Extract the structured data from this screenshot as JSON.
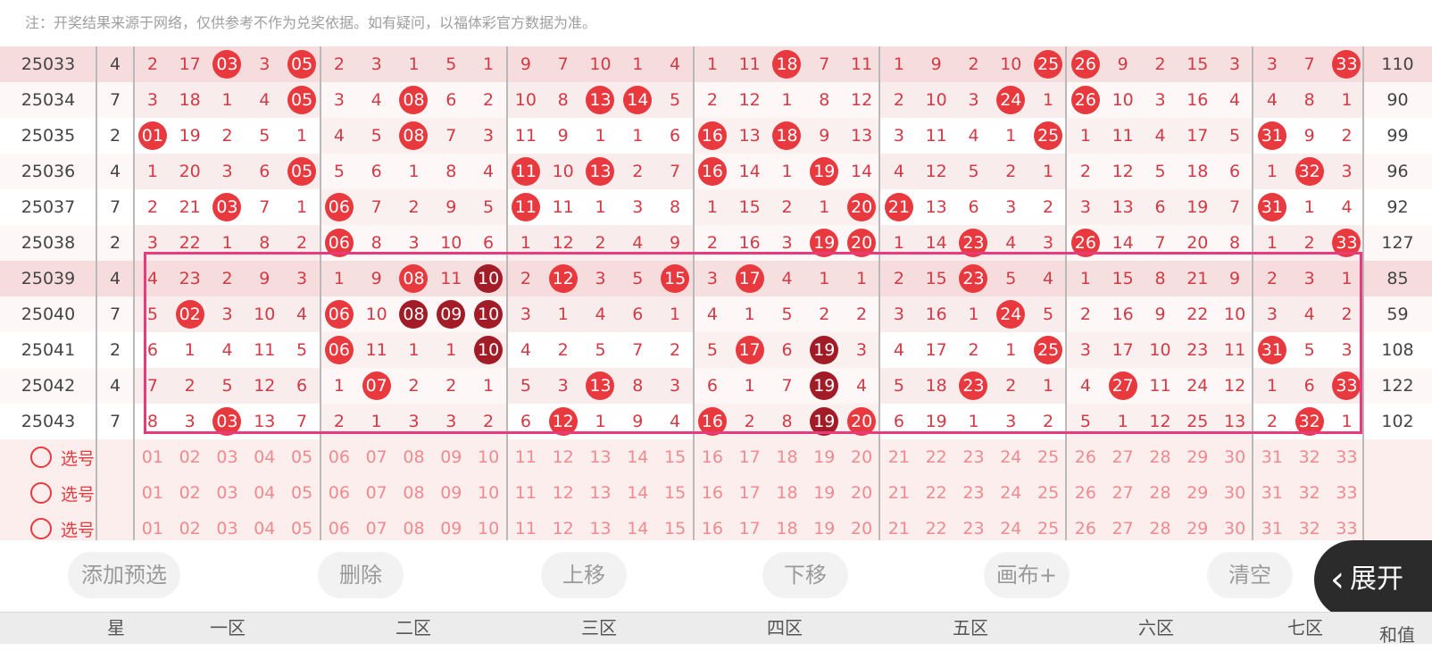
{
  "note": "注：开奖结果来源于网络，仅供参考不作为兑奖依据。如有疑问，以福体彩官方数据为准。",
  "draws": [
    {
      "issue": "25033",
      "star": "4",
      "sum": "110",
      "cells": [
        "2",
        "17",
        "03",
        "3",
        "05",
        "2",
        "3",
        "1",
        "5",
        "1",
        "9",
        "7",
        "10",
        "1",
        "4",
        "1",
        "11",
        "18",
        "7",
        "11",
        "1",
        "9",
        "2",
        "10",
        "25",
        "26",
        "9",
        "2",
        "15",
        "3",
        "3",
        "7",
        "33"
      ],
      "hits": [
        2,
        4,
        17,
        24,
        25,
        32
      ]
    },
    {
      "issue": "25034",
      "star": "7",
      "sum": "90",
      "cells": [
        "3",
        "18",
        "1",
        "4",
        "05",
        "3",
        "4",
        "08",
        "6",
        "2",
        "10",
        "8",
        "13",
        "14",
        "5",
        "2",
        "12",
        "1",
        "8",
        "12",
        "2",
        "10",
        "3",
        "24",
        "1",
        "26",
        "10",
        "3",
        "16",
        "4",
        "4",
        "8",
        "1"
      ],
      "hits": [
        4,
        7,
        12,
        13,
        23,
        25
      ]
    },
    {
      "issue": "25035",
      "star": "2",
      "sum": "99",
      "cells": [
        "01",
        "19",
        "2",
        "5",
        "1",
        "4",
        "5",
        "08",
        "7",
        "3",
        "11",
        "9",
        "1",
        "1",
        "6",
        "16",
        "13",
        "18",
        "9",
        "13",
        "3",
        "11",
        "4",
        "1",
        "25",
        "1",
        "11",
        "4",
        "17",
        "5",
        "31",
        "9",
        "2"
      ],
      "hits": [
        0,
        7,
        15,
        17,
        24,
        30
      ]
    },
    {
      "issue": "25036",
      "star": "4",
      "sum": "96",
      "cells": [
        "1",
        "20",
        "3",
        "6",
        "05",
        "5",
        "6",
        "1",
        "8",
        "4",
        "11",
        "10",
        "13",
        "2",
        "7",
        "16",
        "14",
        "1",
        "19",
        "14",
        "4",
        "12",
        "5",
        "2",
        "1",
        "2",
        "12",
        "5",
        "18",
        "6",
        "1",
        "32",
        "3"
      ],
      "hits": [
        4,
        10,
        12,
        15,
        18,
        31
      ]
    },
    {
      "issue": "25037",
      "star": "7",
      "sum": "92",
      "cells": [
        "2",
        "21",
        "03",
        "7",
        "1",
        "06",
        "7",
        "2",
        "9",
        "5",
        "11",
        "11",
        "1",
        "3",
        "8",
        "1",
        "15",
        "2",
        "1",
        "20",
        "21",
        "13",
        "6",
        "3",
        "2",
        "3",
        "13",
        "6",
        "19",
        "7",
        "31",
        "1",
        "4"
      ],
      "hits": [
        2,
        5,
        10,
        19,
        20,
        30
      ]
    },
    {
      "issue": "25038",
      "star": "2",
      "sum": "127",
      "cells": [
        "3",
        "22",
        "1",
        "8",
        "2",
        "06",
        "8",
        "3",
        "10",
        "6",
        "1",
        "12",
        "2",
        "4",
        "9",
        "2",
        "16",
        "3",
        "19",
        "20",
        "1",
        "14",
        "23",
        "4",
        "3",
        "26",
        "14",
        "7",
        "20",
        "8",
        "1",
        "2",
        "33"
      ],
      "hits": [
        5,
        18,
        19,
        22,
        25,
        32
      ]
    },
    {
      "issue": "25039",
      "star": "4",
      "sum": "85",
      "cells": [
        "4",
        "23",
        "2",
        "9",
        "3",
        "1",
        "9",
        "08",
        "11",
        "10",
        "2",
        "12",
        "3",
        "5",
        "15",
        "3",
        "17",
        "4",
        "1",
        "1",
        "2",
        "15",
        "23",
        "5",
        "4",
        "1",
        "15",
        "8",
        "21",
        "9",
        "2",
        "3",
        "1"
      ],
      "hits": [
        7,
        9,
        11,
        14,
        16,
        22
      ],
      "dark": [
        9
      ]
    },
    {
      "issue": "25040",
      "star": "7",
      "sum": "59",
      "cells": [
        "5",
        "02",
        "3",
        "10",
        "4",
        "06",
        "10",
        "08",
        "09",
        "10",
        "3",
        "1",
        "4",
        "6",
        "1",
        "4",
        "1",
        "5",
        "2",
        "2",
        "3",
        "16",
        "1",
        "24",
        "5",
        "2",
        "16",
        "9",
        "22",
        "10",
        "3",
        "4",
        "2"
      ],
      "hits": [
        1,
        5,
        7,
        8,
        9,
        23
      ],
      "dark": [
        7,
        8,
        9
      ]
    },
    {
      "issue": "25041",
      "star": "2",
      "sum": "108",
      "cells": [
        "6",
        "1",
        "4",
        "11",
        "5",
        "06",
        "11",
        "1",
        "1",
        "10",
        "4",
        "2",
        "5",
        "7",
        "2",
        "5",
        "17",
        "6",
        "19",
        "3",
        "4",
        "17",
        "2",
        "1",
        "25",
        "3",
        "17",
        "10",
        "23",
        "11",
        "31",
        "5",
        "3"
      ],
      "hits": [
        5,
        9,
        16,
        18,
        24,
        30
      ],
      "dark": [
        9,
        18
      ]
    },
    {
      "issue": "25042",
      "star": "4",
      "sum": "122",
      "cells": [
        "7",
        "2",
        "5",
        "12",
        "6",
        "1",
        "07",
        "2",
        "2",
        "1",
        "5",
        "3",
        "13",
        "8",
        "3",
        "6",
        "1",
        "7",
        "19",
        "4",
        "5",
        "18",
        "23",
        "2",
        "1",
        "4",
        "27",
        "11",
        "24",
        "12",
        "1",
        "6",
        "33"
      ],
      "hits": [
        6,
        12,
        18,
        22,
        26,
        32
      ],
      "dark": [
        18
      ]
    },
    {
      "issue": "25043",
      "star": "7",
      "sum": "102",
      "cells": [
        "8",
        "3",
        "03",
        "13",
        "7",
        "2",
        "1",
        "3",
        "3",
        "2",
        "6",
        "12",
        "1",
        "9",
        "4",
        "16",
        "2",
        "8",
        "19",
        "20",
        "6",
        "19",
        "1",
        "3",
        "2",
        "5",
        "1",
        "12",
        "25",
        "13",
        "2",
        "32",
        "1"
      ],
      "hits": [
        2,
        11,
        15,
        18,
        19,
        31
      ],
      "dark": [
        18
      ]
    }
  ],
  "select_label": "选号",
  "select_numbers": [
    "01",
    "02",
    "03",
    "04",
    "05",
    "06",
    "07",
    "08",
    "09",
    "10",
    "11",
    "12",
    "13",
    "14",
    "15",
    "16",
    "17",
    "18",
    "19",
    "20",
    "21",
    "22",
    "23",
    "24",
    "25",
    "26",
    "27",
    "28",
    "29",
    "30",
    "31",
    "32",
    "33"
  ],
  "toolbar": {
    "add_preselect": "添加预选",
    "delete": "删除",
    "move_up": "上移",
    "move_down": "下移",
    "canvas_plus": "画布+",
    "clear": "清空",
    "expand": "展开",
    "expand_chevron": "‹"
  },
  "zones": {
    "star": "星",
    "z1": "一区",
    "z2": "二区",
    "z3": "三区",
    "z4": "四区",
    "z5": "五区",
    "z6": "六区",
    "z7": "七区",
    "sum": "和值"
  },
  "colors": {
    "ball": "#e8393f",
    "ball_dark": "#a11c26",
    "highlight_box": "#e93a7d",
    "text_red": "#d23a45"
  }
}
